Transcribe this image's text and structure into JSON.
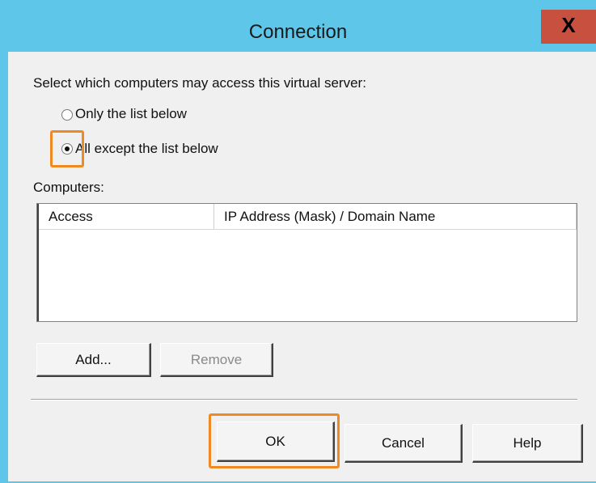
{
  "window": {
    "title": "Connection",
    "close_glyph": "X"
  },
  "prompt": "Select which computers may access this virtual server:",
  "radio_options": [
    {
      "label": "Only the list below",
      "selected": false
    },
    {
      "label": "All except the list below",
      "selected": true
    }
  ],
  "computers_label": "Computers:",
  "list": {
    "columns": [
      "Access",
      "IP Address (Mask) / Domain Name"
    ],
    "rows": []
  },
  "buttons": {
    "add": "Add...",
    "remove": "Remove",
    "ok": "OK",
    "cancel": "Cancel",
    "help": "Help"
  },
  "colors": {
    "titlebar": "#5ec6e8",
    "close": "#c7503f",
    "highlight": "#ef8a22"
  }
}
